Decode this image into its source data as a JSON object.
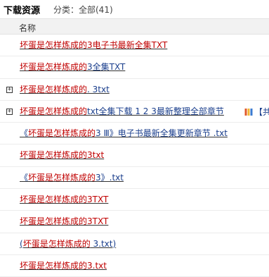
{
  "header": {
    "title": "下载资源",
    "category": "分类：全部(41)"
  },
  "table": {
    "column_name": "名称"
  },
  "rows": [
    {
      "expandable": false,
      "parts": [
        {
          "text": "坏蛋是怎样炼成的",
          "color": "red"
        },
        {
          "text": "3电子书最新全集TXT",
          "color": "red"
        }
      ]
    },
    {
      "expandable": false,
      "parts": [
        {
          "text": "坏蛋是怎样炼成的",
          "color": "red"
        },
        {
          "text": "3全集TXT",
          "color": "blue"
        }
      ]
    },
    {
      "expandable": true,
      "parts": [
        {
          "text": "坏蛋是怎样炼成的",
          "color": "red"
        },
        {
          "text": ". 3txt",
          "color": "blue"
        }
      ]
    },
    {
      "expandable": true,
      "parts": [
        {
          "text": "坏蛋是怎样炼成的",
          "color": "red"
        },
        {
          "text": "txt全集下载 1 2 3最新整理全部章节",
          "color": "blue"
        }
      ],
      "extra": {
        "icon": "book-icon",
        "text": "【共"
      }
    },
    {
      "expandable": false,
      "parts": [
        {
          "text": "《",
          "color": "blue"
        },
        {
          "text": "坏蛋是怎样炼成的",
          "color": "red"
        },
        {
          "text": "3 Ⅲ》电子书最新全集更新章节 .txt",
          "color": "blue"
        }
      ]
    },
    {
      "expandable": false,
      "parts": [
        {
          "text": "坏蛋是怎样炼成的",
          "color": "red"
        },
        {
          "text": "3txt",
          "color": "red"
        }
      ]
    },
    {
      "expandable": false,
      "parts": [
        {
          "text": "《",
          "color": "blue"
        },
        {
          "text": "坏蛋是怎样炼成的",
          "color": "red"
        },
        {
          "text": "3》.txt",
          "color": "blue"
        }
      ]
    },
    {
      "expandable": false,
      "parts": [
        {
          "text": "坏蛋是怎样炼成的",
          "color": "red"
        },
        {
          "text": "3TXT",
          "color": "red"
        }
      ]
    },
    {
      "expandable": false,
      "parts": [
        {
          "text": "坏蛋是怎样炼成的",
          "color": "red"
        },
        {
          "text": "3TXT",
          "color": "red"
        }
      ]
    },
    {
      "expandable": false,
      "parts": [
        {
          "text": "(",
          "color": "blue"
        },
        {
          "text": "坏蛋是怎样炼成的",
          "color": "red"
        },
        {
          "text": " 3.txt)",
          "color": "blue"
        }
      ]
    },
    {
      "expandable": false,
      "parts": [
        {
          "text": "坏蛋是怎样炼成的",
          "color": "red"
        },
        {
          "text": "3.txt",
          "color": "red"
        }
      ]
    }
  ],
  "colors": {
    "red": "#c00000",
    "blue": "#1a3e8c"
  }
}
